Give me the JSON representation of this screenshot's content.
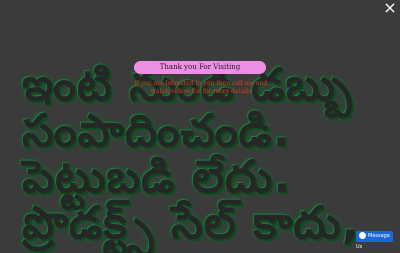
{
  "hero": {
    "text": "ఇంటి నుండి డబ్బు\nసంపాదించండి.\nపెట్టుబడి లేదు.\nప్రొడక్ట్స్ సేల్ కాదు,"
  },
  "popup": {
    "close_label": "×",
    "thanks_label": "Thank you For Visiting",
    "message": "if you are Intrested to join then call me and\nwatch videos for for more details"
  },
  "messenger": {
    "label": "Message Us",
    "icon": "messenger-icon"
  }
}
